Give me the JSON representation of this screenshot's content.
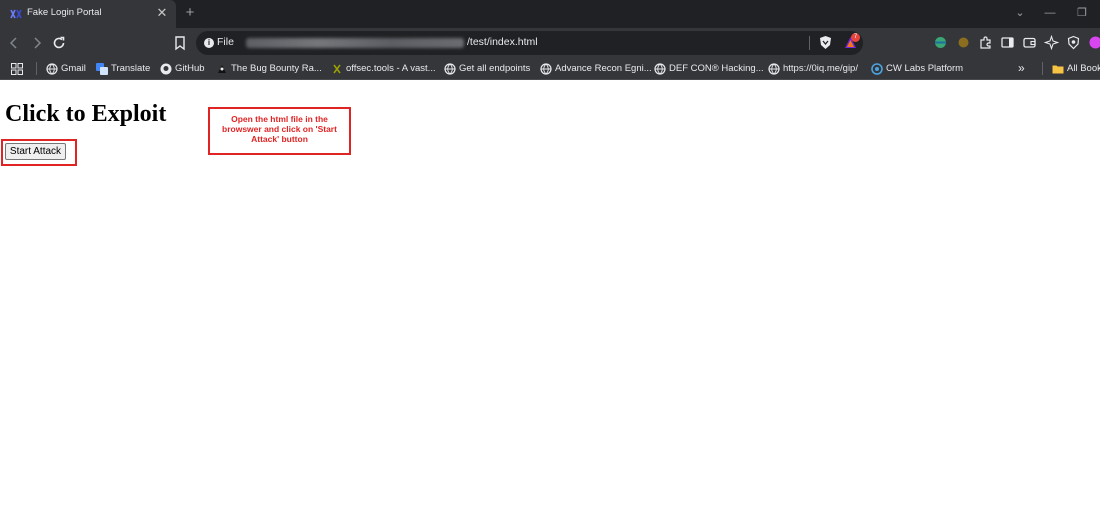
{
  "browser": {
    "tab": {
      "title": "Fake Login Portal",
      "close_glyph": "✕"
    },
    "new_tab_glyph": "+",
    "window_controls": {
      "dropdown": "⌄",
      "minimize": "—",
      "restore": "❐"
    },
    "address_bar": {
      "scheme_label": "File",
      "url_path": "/test/index.html",
      "url_prefix_blurred": true
    },
    "extension_badge_count": "7"
  },
  "bookmarks": [
    {
      "label": "Gmail",
      "icon": "globe-icon"
    },
    {
      "label": "Translate",
      "icon": "translate-icon"
    },
    {
      "label": "GitHub",
      "icon": "github-icon"
    },
    {
      "label": "The Bug Bounty Ra...",
      "icon": "bug-bounty-icon"
    },
    {
      "label": "offsec.tools - A vast...",
      "icon": "offsec-icon"
    },
    {
      "label": "Get all endpoints",
      "icon": "globe-icon"
    },
    {
      "label": "Advance Recon Egni...",
      "icon": "globe-icon"
    },
    {
      "label": "DEF CON® Hacking...",
      "icon": "globe-icon"
    },
    {
      "label": "https://0iq.me/gip/",
      "icon": "globe-icon"
    },
    {
      "label": "CW Labs Platform",
      "icon": "cw-labs-icon"
    }
  ],
  "bookmarks_overflow": "»",
  "all_bookmarks_label": "All Book",
  "page": {
    "heading": "Click to Exploit",
    "start_button": "Start Attack",
    "annotation": "Open the html file in the browswer and click on 'Start Attack' button"
  },
  "colors": {
    "annotation_red": "#e02424",
    "chrome_dark": "#202124",
    "chrome_toolbar": "#35363a"
  }
}
